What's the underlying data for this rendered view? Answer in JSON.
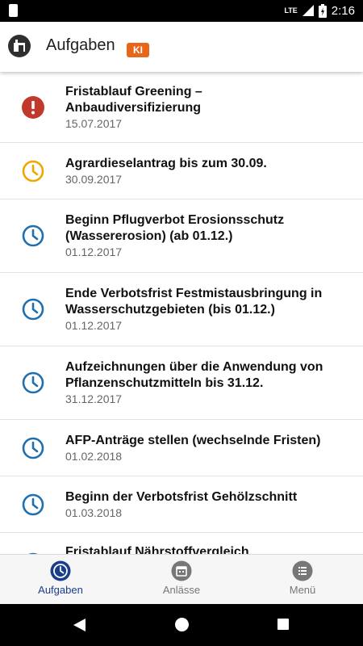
{
  "status_bar": {
    "network": "LTE",
    "time": "2:16"
  },
  "app_bar": {
    "title": "Aufgaben",
    "badge": "KI"
  },
  "colors": {
    "overdue": "#c0392b",
    "warning": "#f0a500",
    "upcoming": "#1f6fae",
    "nav_active": "#1a3e8c",
    "nav_inactive": "#777777"
  },
  "tasks": [
    {
      "title": "Fristablauf Greening – Anbaudiversifizierung",
      "date": "15.07.2017",
      "icon": "exclamation-icon"
    },
    {
      "title": "Agrardieselantrag bis zum 30.09.",
      "date": "30.09.2017",
      "icon": "clock-icon"
    },
    {
      "title": "Beginn Pflugverbot Erosionsschutz (Wassererosion) (ab 01.12.)",
      "date": "01.12.2017",
      "icon": "clock-icon"
    },
    {
      "title": "Ende Verbotsfrist Festmistausbringung in Wasserschutzgebieten (bis 01.12.)",
      "date": "01.12.2017",
      "icon": "clock-icon"
    },
    {
      "title": "Aufzeichnungen über die Anwendung von Pflanzenschutzmitteln bis 31.12.",
      "date": "31.12.2017",
      "icon": "clock-icon"
    },
    {
      "title": "AFP-Anträge stellen (wechselnde Fristen)",
      "date": "01.02.2018",
      "icon": "clock-icon"
    },
    {
      "title": "Beginn der Verbotsfrist Gehölzschnitt",
      "date": "01.03.2018",
      "icon": "clock-icon"
    },
    {
      "title": "Fristablauf Nährstoffvergleich",
      "date": "",
      "icon": "clock-icon"
    }
  ],
  "bottom_nav": [
    {
      "label": "Aufgaben",
      "icon": "clock-icon",
      "active": true
    },
    {
      "label": "Anlässe",
      "icon": "calendar-icon",
      "active": false
    },
    {
      "label": "Menü",
      "icon": "menu-list-icon",
      "active": false
    }
  ]
}
